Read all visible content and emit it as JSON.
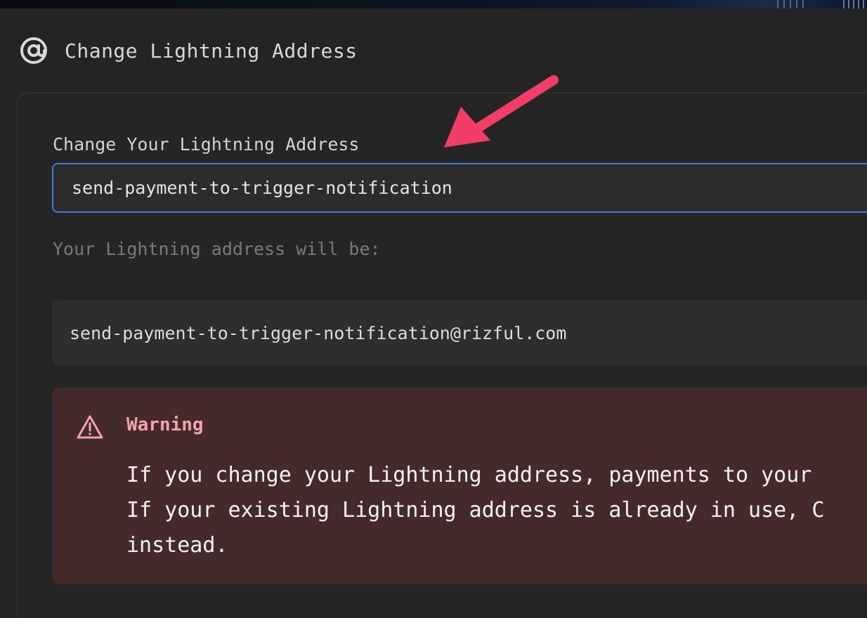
{
  "header": {
    "icon": "at-sign-icon",
    "title": "Change Lightning Address"
  },
  "form": {
    "label": "Change Your Lightning Address",
    "input_value": "send-payment-to-trigger-notification",
    "preview_label": "Your Lightning address will be:",
    "preview_address": "send-payment-to-trigger-notification@rizful.com"
  },
  "warning": {
    "icon": "warning-triangle-icon",
    "title": "Warning",
    "lines": [
      "If you change your Lightning address, payments to your",
      "If your existing Lightning address is already in use, C",
      "instead."
    ]
  },
  "annotation": {
    "icon": "pointer-arrow-icon",
    "color": "#f23d66"
  },
  "colors": {
    "accent": "#3b7fd4",
    "warning_bg": "#452a2b",
    "warning_title": "#f3a3a8"
  }
}
